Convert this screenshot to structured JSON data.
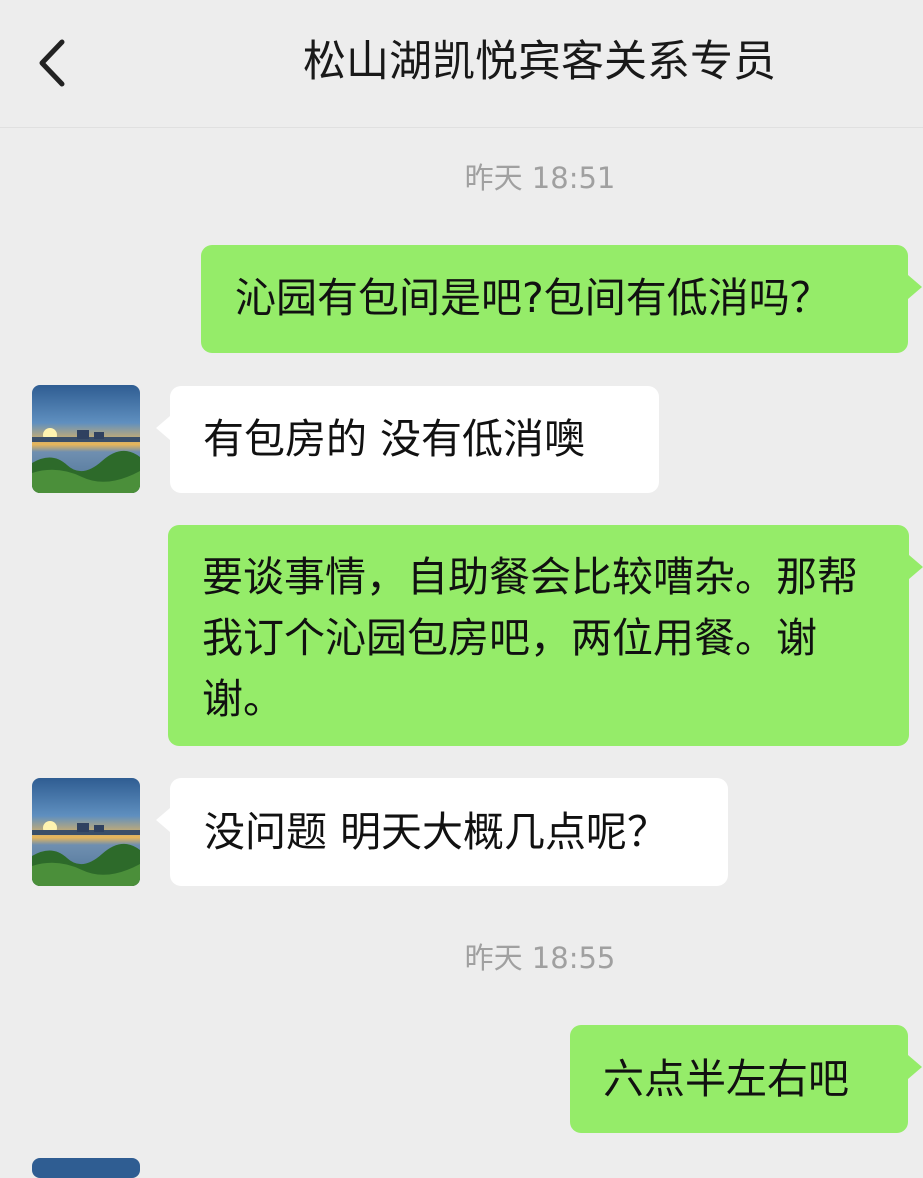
{
  "header": {
    "title": "松山湖凯悦宾客关系专员",
    "back_icon": "chevron-left-icon"
  },
  "timestamps": [
    "昨天 18:51",
    "昨天 18:55"
  ],
  "messages": [
    {
      "side": "out",
      "text": "沁园有包间是吧?包间有低消吗？"
    },
    {
      "side": "in",
      "text": "有包房的 没有低消噢"
    },
    {
      "side": "out",
      "text": "要谈事情，自助餐会比较嘈杂。那帮我订个沁园包房吧，两位用餐。谢谢。"
    },
    {
      "side": "in",
      "text": "没问题 明天大概几点呢？"
    },
    {
      "side": "out",
      "text": "六点半左右吧"
    }
  ],
  "colors": {
    "background": "#ededed",
    "outgoing_bubble": "#95ec69",
    "incoming_bubble": "#ffffff",
    "timestamp": "#a0a0a0"
  }
}
